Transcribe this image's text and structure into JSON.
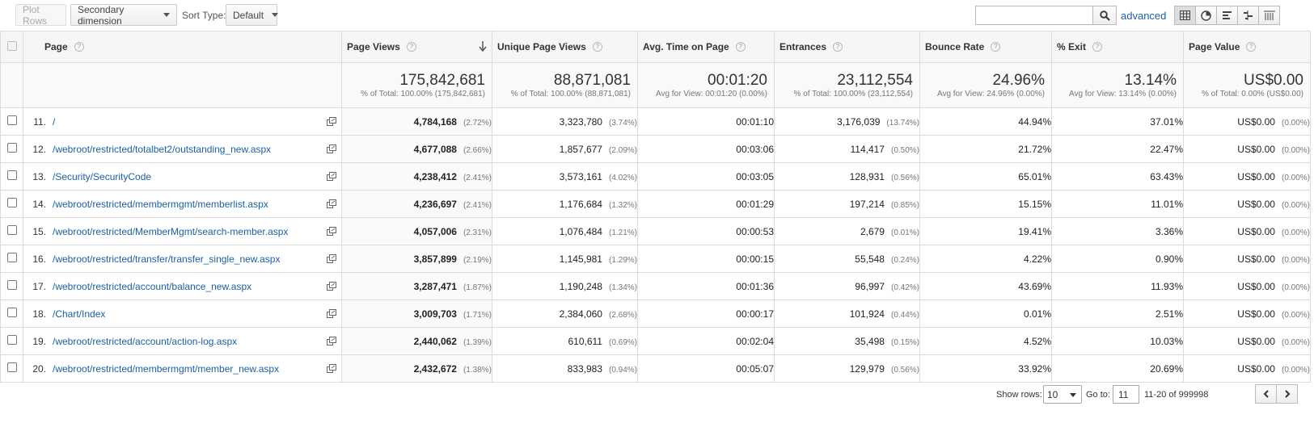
{
  "toolbar": {
    "plot_rows": "Plot Rows",
    "secondary_dimension": "Secondary dimension",
    "sort_type_label": "Sort Type:",
    "sort_type_value": "Default",
    "search_placeholder": "",
    "advanced": "advanced",
    "view_icons": [
      "table-view-icon",
      "pie-view-icon",
      "performance-view-icon",
      "comparison-view-icon",
      "pivot-view-icon"
    ]
  },
  "headers": {
    "page": "Page",
    "page_views": "Page Views",
    "unique_page_views": "Unique Page Views",
    "avg_time": "Avg. Time on Page",
    "entrances": "Entrances",
    "bounce_rate": "Bounce Rate",
    "exit": "% Exit",
    "page_value": "Page Value"
  },
  "totals": {
    "page_views": "175,842,681",
    "page_views_sub": "% of Total: 100.00% (175,842,681)",
    "unique_page_views": "88,871,081",
    "unique_page_views_sub": "% of Total: 100.00% (88,871,081)",
    "avg_time": "00:01:20",
    "avg_time_sub": "Avg for View: 00:01:20 (0.00%)",
    "entrances": "23,112,554",
    "entrances_sub": "% of Total: 100.00% (23,112,554)",
    "bounce_rate": "24.96%",
    "bounce_rate_sub": "Avg for View: 24.96% (0.00%)",
    "exit": "13.14%",
    "exit_sub": "Avg for View: 13.14% (0.00%)",
    "page_value": "US$0.00",
    "page_value_sub": "% of Total: 0.00% (US$0.00)"
  },
  "rows": [
    {
      "n": "11.",
      "page": "/",
      "pv": "4,784,168",
      "pv_pct": "(2.72%)",
      "upv": "3,323,780",
      "upv_pct": "(3.74%)",
      "time": "00:01:10",
      "ent": "3,176,039",
      "ent_pct": "(13.74%)",
      "bounce": "44.94%",
      "exit": "37.01%",
      "value": "US$0.00",
      "value_pct": "(0.00%)"
    },
    {
      "n": "12.",
      "page": "/webroot/restricted/totalbet2/outstanding_new.aspx",
      "pv": "4,677,088",
      "pv_pct": "(2.66%)",
      "upv": "1,857,677",
      "upv_pct": "(2.09%)",
      "time": "00:03:06",
      "ent": "114,417",
      "ent_pct": "(0.50%)",
      "bounce": "21.72%",
      "exit": "22.47%",
      "value": "US$0.00",
      "value_pct": "(0.00%)"
    },
    {
      "n": "13.",
      "page": "/Security/SecurityCode",
      "pv": "4,238,412",
      "pv_pct": "(2.41%)",
      "upv": "3,573,161",
      "upv_pct": "(4.02%)",
      "time": "00:03:05",
      "ent": "128,931",
      "ent_pct": "(0.56%)",
      "bounce": "65.01%",
      "exit": "63.43%",
      "value": "US$0.00",
      "value_pct": "(0.00%)"
    },
    {
      "n": "14.",
      "page": "/webroot/restricted/membermgmt/memberlist.aspx",
      "pv": "4,236,697",
      "pv_pct": "(2.41%)",
      "upv": "1,176,684",
      "upv_pct": "(1.32%)",
      "time": "00:01:29",
      "ent": "197,214",
      "ent_pct": "(0.85%)",
      "bounce": "15.15%",
      "exit": "11.01%",
      "value": "US$0.00",
      "value_pct": "(0.00%)"
    },
    {
      "n": "15.",
      "page": "/webroot/restricted/MemberMgmt/search-member.aspx",
      "pv": "4,057,006",
      "pv_pct": "(2.31%)",
      "upv": "1,076,484",
      "upv_pct": "(1.21%)",
      "time": "00:00:53",
      "ent": "2,679",
      "ent_pct": "(0.01%)",
      "bounce": "19.41%",
      "exit": "3.36%",
      "value": "US$0.00",
      "value_pct": "(0.00%)"
    },
    {
      "n": "16.",
      "page": "/webroot/restricted/transfer/transfer_single_new.aspx",
      "pv": "3,857,899",
      "pv_pct": "(2.19%)",
      "upv": "1,145,981",
      "upv_pct": "(1.29%)",
      "time": "00:00:15",
      "ent": "55,548",
      "ent_pct": "(0.24%)",
      "bounce": "4.22%",
      "exit": "0.90%",
      "value": "US$0.00",
      "value_pct": "(0.00%)"
    },
    {
      "n": "17.",
      "page": "/webroot/restricted/account/balance_new.aspx",
      "pv": "3,287,471",
      "pv_pct": "(1.87%)",
      "upv": "1,190,248",
      "upv_pct": "(1.34%)",
      "time": "00:01:36",
      "ent": "96,997",
      "ent_pct": "(0.42%)",
      "bounce": "43.69%",
      "exit": "11.93%",
      "value": "US$0.00",
      "value_pct": "(0.00%)"
    },
    {
      "n": "18.",
      "page": "/Chart/Index",
      "pv": "3,009,703",
      "pv_pct": "(1.71%)",
      "upv": "2,384,060",
      "upv_pct": "(2.68%)",
      "time": "00:00:17",
      "ent": "101,924",
      "ent_pct": "(0.44%)",
      "bounce": "0.01%",
      "exit": "2.51%",
      "value": "US$0.00",
      "value_pct": "(0.00%)"
    },
    {
      "n": "19.",
      "page": "/webroot/restricted/account/action-log.aspx",
      "pv": "2,440,062",
      "pv_pct": "(1.39%)",
      "upv": "610,611",
      "upv_pct": "(0.69%)",
      "time": "00:02:04",
      "ent": "35,498",
      "ent_pct": "(0.15%)",
      "bounce": "4.52%",
      "exit": "10.03%",
      "value": "US$0.00",
      "value_pct": "(0.00%)"
    },
    {
      "n": "20.",
      "page": "/webroot/restricted/membermgmt/member_new.aspx",
      "pv": "2,432,672",
      "pv_pct": "(1.38%)",
      "upv": "833,983",
      "upv_pct": "(0.94%)",
      "time": "00:05:07",
      "ent": "129,979",
      "ent_pct": "(0.56%)",
      "bounce": "33.92%",
      "exit": "20.69%",
      "value": "US$0.00",
      "value_pct": "(0.00%)"
    }
  ],
  "footer": {
    "show_rows_label": "Show rows:",
    "show_rows_value": "10",
    "goto_label": "Go to:",
    "goto_value": "11",
    "range": "11-20 of 999998"
  }
}
